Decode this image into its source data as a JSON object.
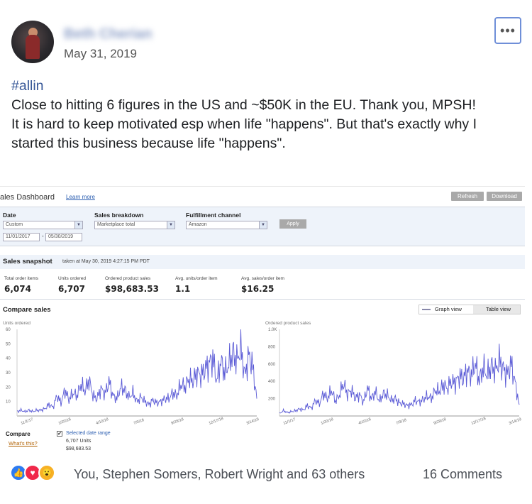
{
  "post": {
    "author": "Beth Cherian",
    "date": "May 31, 2019",
    "more_icon": "•••",
    "hashtag": "#allin",
    "line1": "Close to hitting 6 figures in the US and ~$50K in the EU. Thank you, MPSH!",
    "line2": "It is hard to keep motivated esp when life \"happens\". But that's exactly why I started this business because life \"happens\"."
  },
  "dashboard": {
    "title": "ales Dashboard",
    "learn_more": "Learn more",
    "refresh": "Refresh",
    "download": "Download",
    "filters": {
      "date_label": "Date",
      "date_value": "Custom",
      "date_from": "11/01/2017",
      "date_sep": "-",
      "date_to": "05/30/2019",
      "breakdown_label": "Sales breakdown",
      "breakdown_value": "Marketplace total",
      "channel_label": "Fulfillment channel",
      "channel_value": "Amazon",
      "apply": "Apply"
    },
    "snapshot": {
      "title": "Sales snapshot",
      "taken": "taken at May 30, 2019 4:27:15 PM PDT",
      "metrics": [
        {
          "label": "Total order items",
          "value": "6,074"
        },
        {
          "label": "Units ordered",
          "value": "6,707"
        },
        {
          "label": "Ordered product sales",
          "value": "$98,683.53"
        },
        {
          "label": "Avg. units/order item",
          "value": "1.1"
        },
        {
          "label": "Avg. sales/order item",
          "value": "$16.25"
        }
      ]
    },
    "compare": {
      "title": "Compare sales",
      "graph_view": "Graph view",
      "table_view": "Table view",
      "compare_label": "Compare",
      "whats_this": "What's this?",
      "check_mark": "✔",
      "selected_range": "Selected date range",
      "units": "6,707 Units",
      "sales": "$98,683.53"
    }
  },
  "chart_data": [
    {
      "type": "line",
      "title": "",
      "ylabel": "Units ordered",
      "ylim": [
        0,
        60
      ],
      "yticks": [
        "60",
        "50",
        "40",
        "30",
        "20",
        "10"
      ],
      "xticks": [
        "11/1/17",
        "1/20/18",
        "4/10/18",
        "7/9/18",
        "9/28/18",
        "12/17/18",
        "3/14/19"
      ],
      "color": "#5b5bd6",
      "series": [
        {
          "values": [
            3,
            4,
            3,
            4,
            3,
            4,
            4,
            5,
            8,
            6,
            14,
            9,
            18,
            11,
            16,
            14,
            22,
            17,
            25,
            14,
            12,
            19,
            15,
            24,
            14,
            12,
            20,
            18,
            13,
            16,
            10,
            13,
            10,
            8,
            11,
            9,
            10,
            12,
            12,
            16,
            14,
            22,
            20,
            26,
            24,
            30,
            28,
            32,
            36,
            40,
            24,
            38,
            30,
            36,
            44,
            38,
            48,
            28,
            42,
            34,
            12
          ]
        }
      ]
    },
    {
      "type": "line",
      "title": "",
      "ylabel": "Ordered product sales",
      "ylim": [
        0,
        1000
      ],
      "yticks": [
        "1.0K",
        "800",
        "600",
        "400",
        "200"
      ],
      "xticks": [
        "11/1/17",
        "1/20/18",
        "4/10/18",
        "7/9/18",
        "9/28/18",
        "12/17/18",
        "3/14/19"
      ],
      "color": "#5b5bd6",
      "series": [
        {
          "values": [
            30,
            60,
            40,
            50,
            60,
            80,
            70,
            120,
            90,
            180,
            140,
            260,
            200,
            300,
            170,
            240,
            380,
            250,
            300,
            200,
            250,
            160,
            320,
            200,
            280,
            170,
            260,
            240,
            180,
            200,
            150,
            140,
            120,
            130,
            180,
            160,
            190,
            230,
            200,
            300,
            280,
            360,
            320,
            400,
            380,
            460,
            430,
            520,
            480,
            600,
            410,
            560,
            470,
            580,
            520,
            640,
            540,
            480,
            600,
            380,
            130
          ]
        }
      ]
    }
  ],
  "footer": {
    "like_icon": "👍",
    "love_icon": "♥",
    "wow_icon": "😮",
    "reactions_text": "You, Stephen Somers, Robert Wright and 63 others",
    "comments_text": "16 Comments"
  }
}
